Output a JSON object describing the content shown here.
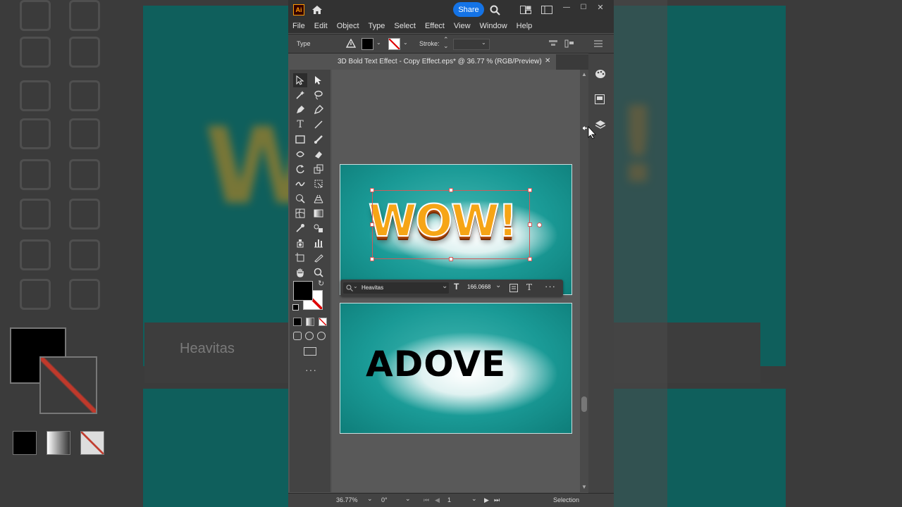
{
  "window": {
    "app_icon": "Ai",
    "share_label": "Share",
    "min_label": "—",
    "max_label": "☐",
    "close_label": "✕"
  },
  "menu": [
    "File",
    "Edit",
    "Object",
    "Type",
    "Select",
    "Effect",
    "View",
    "Window",
    "Help"
  ],
  "control_bar": {
    "type_label": "Type",
    "stroke_label": "Stroke:",
    "fill_color": "#000000"
  },
  "document_tab": {
    "title": "3D Bold Text Effect - Copy Effect.eps* @ 36.77 % (RGB/Preview)",
    "close": "✕"
  },
  "artboard1": {
    "text": "WOW!",
    "bg_color": "#1a9a96"
  },
  "contextual_bar": {
    "font_name": "Heavitas",
    "font_size": "166.0668"
  },
  "artboard2": {
    "text": "ADOVE",
    "bg_color": "#1a9a96"
  },
  "status": {
    "zoom": "36.77%",
    "rotation": "0°",
    "artboard_num": "1",
    "mode": "Selection"
  },
  "background": {
    "font_name": "Heavitas"
  },
  "colors": {
    "accent": "#1473e6",
    "teal": "#1a9a96",
    "selection": "#d05a5a"
  }
}
